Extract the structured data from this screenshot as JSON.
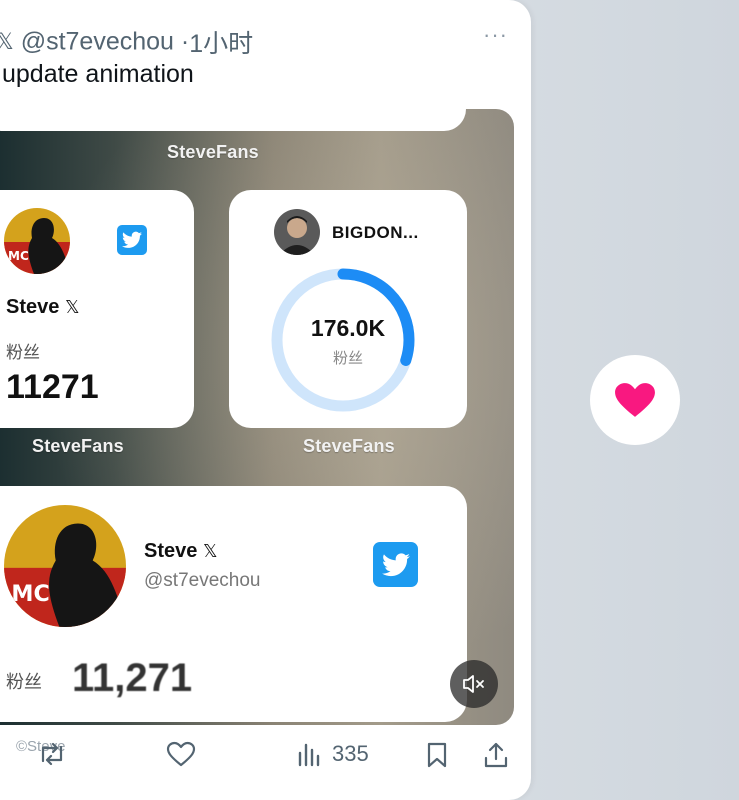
{
  "tweet": {
    "handle": "@st7evechou",
    "separator": "·",
    "time": "1小时",
    "text": "update animation",
    "more_label": "···"
  },
  "media": {
    "captions": [
      "SteveFans",
      "SteveFans",
      "SteveFans"
    ],
    "widget_small": {
      "name": "Steve",
      "followers_label": "粉丝",
      "followers_value": "11271"
    },
    "widget_ring": {
      "name": "BIGDON...",
      "value": "176.0K",
      "label": "粉丝",
      "progress_fraction": 0.3
    },
    "widget_large": {
      "name": "Steve",
      "handle": "@st7evechou",
      "followers_label": "粉丝",
      "followers_value": "11,271"
    },
    "watermark": "©Steve"
  },
  "actions": {
    "views_count": "335"
  },
  "colors": {
    "twitter_blue": "#1d9bf0",
    "heart_pink": "#f91880",
    "ring_blue": "#1d8cf5",
    "ring_track": "#cfe5fb"
  }
}
